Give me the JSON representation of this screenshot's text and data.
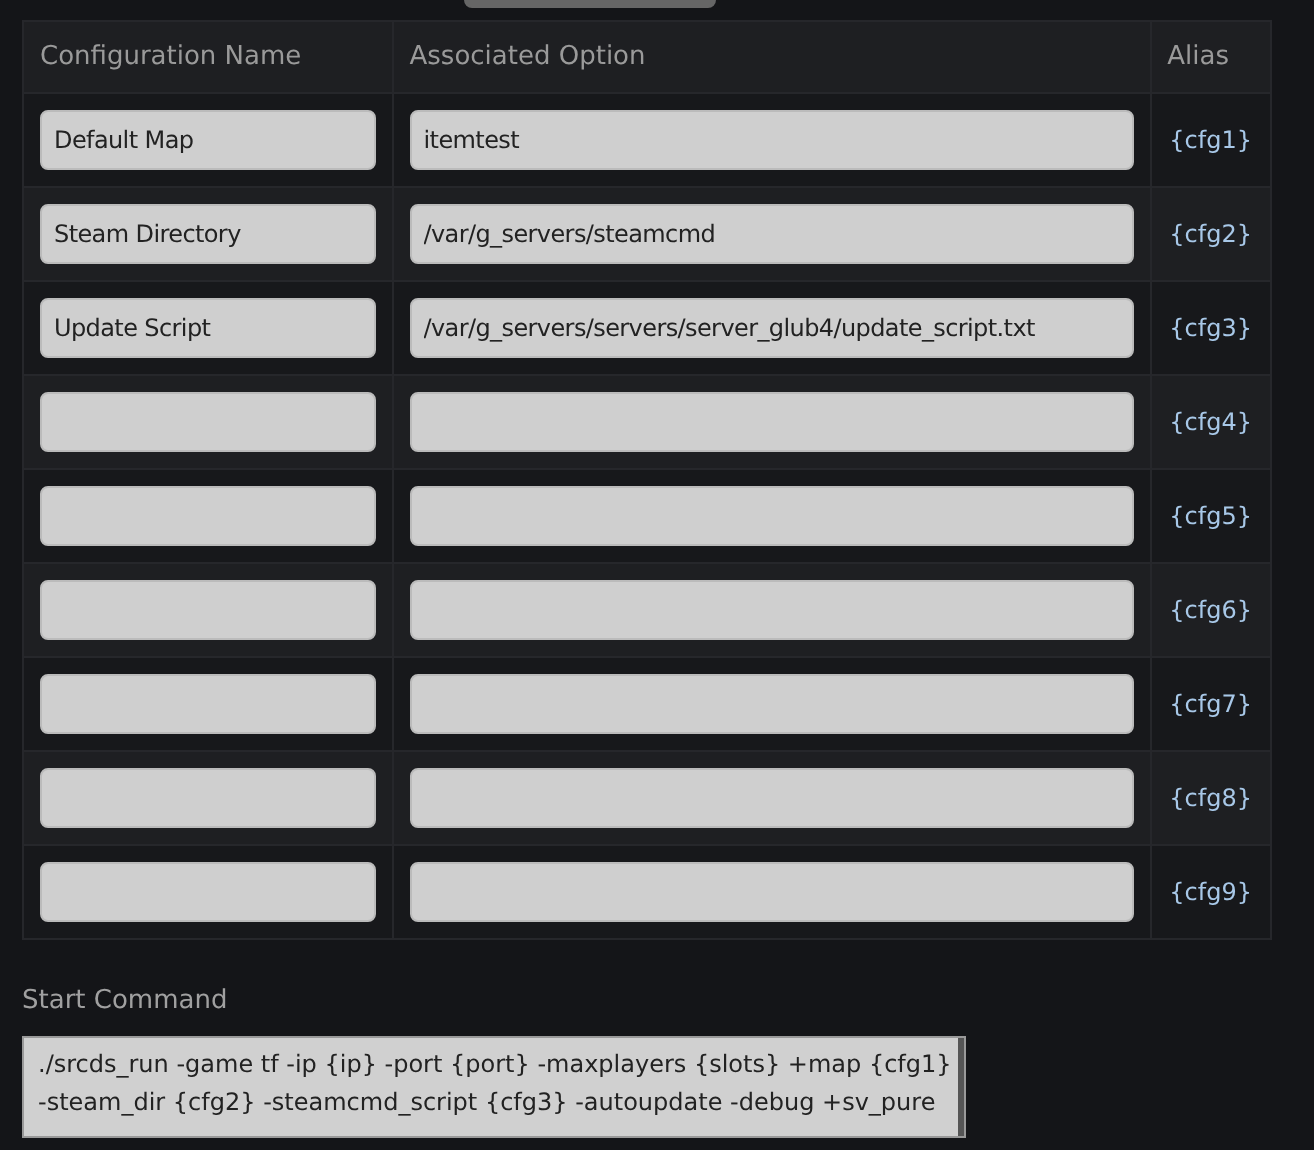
{
  "table": {
    "columns": [
      "Configuration Name",
      "Associated Option",
      "Alias"
    ],
    "rows": [
      {
        "name": "Default Map",
        "option": "itemtest",
        "alias": "{cfg1}"
      },
      {
        "name": "Steam Directory",
        "option": "/var/g_servers/steamcmd",
        "alias": "{cfg2}"
      },
      {
        "name": "Update Script",
        "option": "/var/g_servers/servers/server_glub4/update_script.txt",
        "alias": "{cfg3}"
      },
      {
        "alias": "{cfg4}"
      },
      {
        "alias": "{cfg5}"
      },
      {
        "alias": "{cfg6}"
      },
      {
        "alias": "{cfg7}"
      },
      {
        "alias": "{cfg8}"
      },
      {
        "alias": "{cfg9}"
      }
    ]
  },
  "start_command": {
    "label": "Start Command",
    "lines": [
      "./srcds_run -game tf -ip {ip} -port {port} -maxplayers {slots} +map {cfg1}",
      "-steam_dir {cfg2} -steamcmd_script {cfg3} -autoupdate -debug +sv_pure"
    ]
  }
}
